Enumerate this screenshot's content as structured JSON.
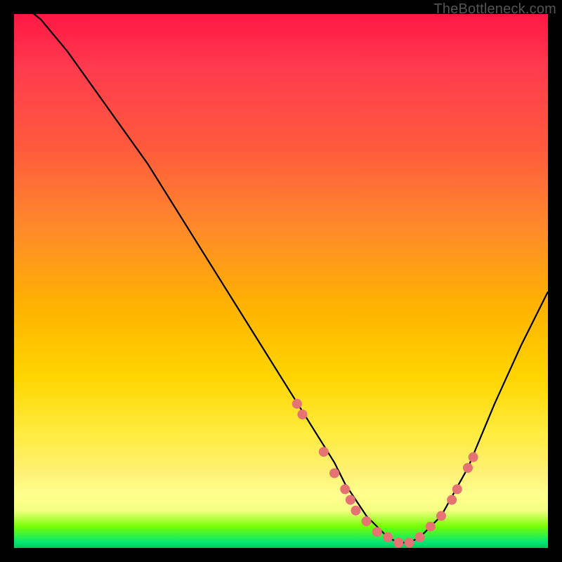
{
  "watermark": "TheBottleneck.com",
  "chart_data": {
    "type": "line",
    "title": "",
    "xlabel": "",
    "ylabel": "",
    "xlim": [
      0,
      100
    ],
    "ylim": [
      0,
      100
    ],
    "grid": false,
    "legend": null,
    "series": [
      {
        "name": "bottleneck-curve",
        "x": [
          0,
          5,
          10,
          15,
          20,
          25,
          30,
          35,
          40,
          45,
          50,
          55,
          60,
          62,
          64,
          66,
          68,
          70,
          72,
          74,
          76,
          80,
          85,
          90,
          95,
          100
        ],
        "y_pct": [
          103,
          99,
          93,
          86,
          79,
          72,
          64,
          56,
          48,
          40,
          32,
          24,
          16,
          12,
          9,
          6,
          4,
          2,
          1,
          1,
          2,
          6,
          15,
          27,
          38,
          48
        ]
      }
    ],
    "scatter_points": {
      "name": "highlight-dots",
      "color": "#e57373",
      "radius": 7,
      "points": [
        {
          "x": 53,
          "y_pct": 27
        },
        {
          "x": 54,
          "y_pct": 25
        },
        {
          "x": 58,
          "y_pct": 18
        },
        {
          "x": 60,
          "y_pct": 14
        },
        {
          "x": 62,
          "y_pct": 11
        },
        {
          "x": 63,
          "y_pct": 9
        },
        {
          "x": 64,
          "y_pct": 7
        },
        {
          "x": 66,
          "y_pct": 5
        },
        {
          "x": 68,
          "y_pct": 3
        },
        {
          "x": 70,
          "y_pct": 2
        },
        {
          "x": 72,
          "y_pct": 1
        },
        {
          "x": 74,
          "y_pct": 1
        },
        {
          "x": 76,
          "y_pct": 2
        },
        {
          "x": 78,
          "y_pct": 4
        },
        {
          "x": 80,
          "y_pct": 6
        },
        {
          "x": 82,
          "y_pct": 9
        },
        {
          "x": 83,
          "y_pct": 11
        },
        {
          "x": 85,
          "y_pct": 15
        },
        {
          "x": 86,
          "y_pct": 17
        }
      ]
    }
  }
}
